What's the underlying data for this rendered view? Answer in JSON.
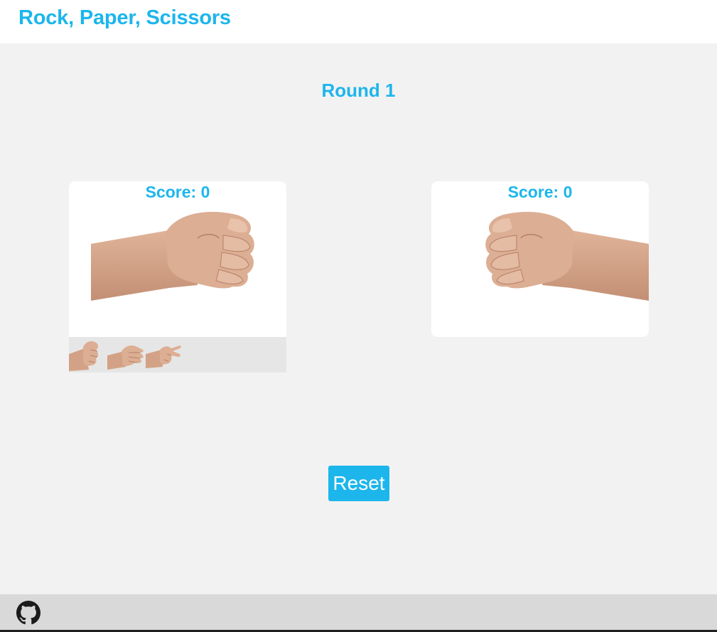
{
  "header": {
    "title": "Rock, Paper, Scissors"
  },
  "game": {
    "round_label": "Round 1",
    "player": {
      "score_label": "Score: 0",
      "current_hand": "rock-hand-icon"
    },
    "computer": {
      "score_label": "Score: 0",
      "current_hand": "rock-hand-icon"
    },
    "choices": [
      {
        "name": "rock",
        "icon": "rock-hand-icon"
      },
      {
        "name": "paper",
        "icon": "paper-hand-icon"
      },
      {
        "name": "scissors",
        "icon": "scissors-hand-icon"
      }
    ]
  },
  "controls": {
    "reset_label": "Reset"
  },
  "footer": {
    "github_icon": "github-icon"
  },
  "colors": {
    "accent": "#1cb6ec",
    "background": "#f2f2f2",
    "card": "#ffffff",
    "choice_bar": "#e6e6e6",
    "footer": "#d9d9d9",
    "skin": "#d8a98c"
  }
}
